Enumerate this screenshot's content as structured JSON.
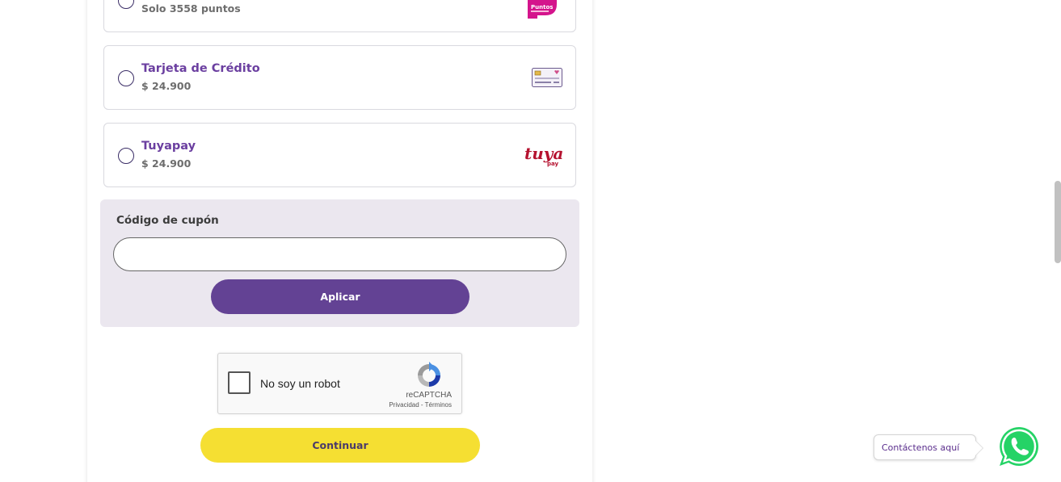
{
  "payment_options": [
    {
      "title": "",
      "subtitle": "Solo 3558 puntos",
      "logo": "puntos-colombia-logo",
      "logo_text": "Puntos"
    },
    {
      "title": "Tarjeta de Crédito",
      "subtitle": "$ 24.900",
      "logo": "credit-card-icon"
    },
    {
      "title": "Tuyapay",
      "subtitle": "$ 24.900",
      "logo": "tuyapay-logo",
      "logo_text": "tuya",
      "logo_sub": "pay"
    }
  ],
  "coupon": {
    "label": "Código de cupón",
    "input_value": "",
    "apply_label": "Aplicar"
  },
  "captcha": {
    "label": "No soy un robot",
    "brand": "reCAPTCHA",
    "links": "Privacidad - Términos"
  },
  "continue_label": "Continuar",
  "contact": {
    "label": "Contáctenos aquí"
  },
  "colors": {
    "primary": "#634294",
    "accent_yellow": "#f5df32",
    "title_purple": "#6b3fa0",
    "coupon_bg": "#ebe7ef",
    "whatsapp_green": "#25d366"
  }
}
